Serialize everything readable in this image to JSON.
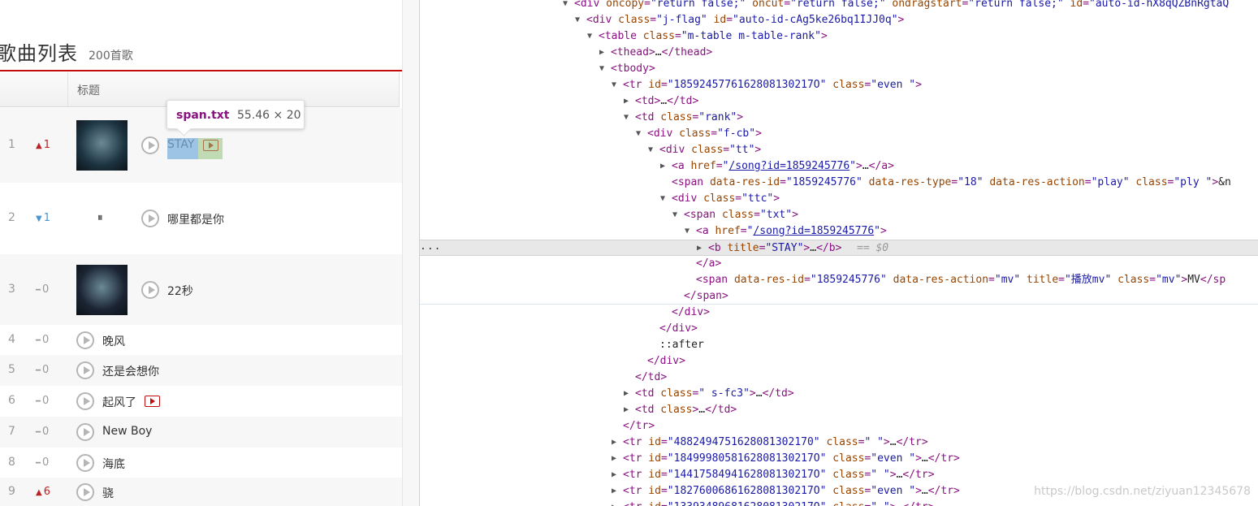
{
  "page": {
    "title": "歌曲列表",
    "count": "200首歌",
    "column_title": "标题",
    "songs": [
      {
        "rank": "1",
        "trend_dir": "up",
        "trend": "1",
        "name": "STAY",
        "has_cover": true,
        "has_mv": true,
        "cover_color": "#1c3340"
      },
      {
        "rank": "2",
        "trend_dir": "down",
        "trend": "1",
        "name": "哪里都是你",
        "has_cover": false,
        "paused": true
      },
      {
        "rank": "3",
        "trend_dir": "flat",
        "trend": "0",
        "name": "22秒",
        "has_cover": true,
        "cover_color": "#1b2433"
      },
      {
        "rank": "4",
        "trend_dir": "flat",
        "trend": "0",
        "name": "晚风"
      },
      {
        "rank": "5",
        "trend_dir": "flat",
        "trend": "0",
        "name": "还是会想你"
      },
      {
        "rank": "6",
        "trend_dir": "flat",
        "trend": "0",
        "name": "起风了",
        "has_mv": true
      },
      {
        "rank": "7",
        "trend_dir": "flat",
        "trend": "0",
        "name": "New Boy"
      },
      {
        "rank": "8",
        "trend_dir": "flat",
        "trend": "0",
        "name": "海底"
      },
      {
        "rank": "9",
        "trend_dir": "up",
        "trend": "6",
        "name": "骁"
      }
    ]
  },
  "tooltip": {
    "selector": "span.txt",
    "dimensions": "55.46 × 20"
  },
  "devtools": {
    "dots": "...",
    "selected_suffix": "== $0",
    "watermark": "https://blog.csdn.net/ziyuan12345678",
    "lines": [
      "<div oncopy=\"return false;\" oncut=\"return false;\" ondragstart=\"return false;\" id=\"auto-id-hX8qQZBnRgtaQ",
      "<div class=\"j-flag\" id=\"auto-id-cAg5ke26bq1IJJ0q\">",
      "<table class=\"m-table m-table-rank\">",
      "<thead>…</thead>",
      "<tbody>",
      "<tr id=\"1859245776162808130217O\" class=\"even \">",
      "<td>…</td>",
      "<td class=\"rank\">",
      "<div class=\"f-cb\">",
      "<div class=\"tt\">",
      "<a href=\"/song?id=1859245776\">…</a>",
      "<span data-res-id=\"1859245776\" data-res-type=\"18\" data-res-action=\"play\" class=\"ply \">&n",
      "<div class=\"ttc\">",
      "<span class=\"txt\">",
      "<a href=\"/song?id=1859245776\">",
      "<b title=\"STAY\">…</b>",
      "</a>",
      "<span data-res-id=\"1859245776\" data-res-action=\"mv\" title=\"播放mv\" class=\"mv\">MV</sp",
      "</span>",
      "</div>",
      "</div>",
      "::after",
      "</div>",
      "</td>",
      "<td class=\" s-fc3\">…</td>",
      "<td class>…</td>",
      "</tr>",
      "<tr id=\"4882494751628081302170\" class=\" \">…</tr>",
      "<tr id=\"1849998058162808130217O\" class=\"even \">…</tr>",
      "<tr id=\"1441758494162808130217O\" class=\" \">…</tr>",
      "<tr id=\"1827600686162808130217O\" class=\"even \">…</tr>",
      "<tr id=\"1339348968162808130217O\" class=\" \">…</tr>"
    ]
  }
}
